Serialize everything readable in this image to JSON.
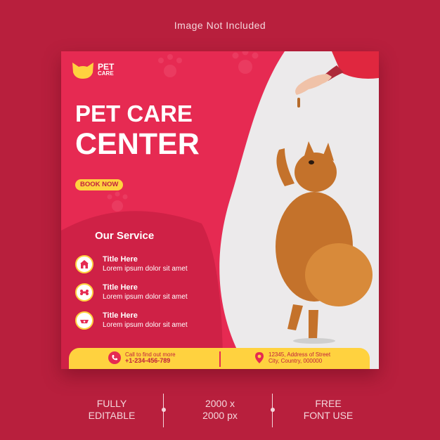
{
  "top_note": "Image Not Included",
  "logo": {
    "line1": "PET",
    "line2": "CARE"
  },
  "headline": {
    "line1": "PET CARE",
    "line2": "CENTER"
  },
  "cta": {
    "label": "BOOK NOW"
  },
  "services": {
    "title": "Our Service",
    "items": [
      {
        "title": "Title Here",
        "desc": "Lorem ipsum dolor sit amet",
        "icon": "dog-house-icon"
      },
      {
        "title": "Title Here",
        "desc": "Lorem ipsum dolor sit amet",
        "icon": "bone-icon"
      },
      {
        "title": "Title Here",
        "desc": "Lorem ipsum dolor sit amet",
        "icon": "pet-bowl-icon"
      }
    ]
  },
  "footer": {
    "phone_label": "Call to find out more",
    "phone": "+1-234-456-789",
    "address_line1": "12345, Address of Street",
    "address_line2": "City, Country, 000000"
  },
  "features": [
    {
      "line1": "FULLY",
      "line2": "EDITABLE"
    },
    {
      "line1": "2000 x",
      "line2": "2000 px"
    },
    {
      "line1": "FREE",
      "line2": "FONT USE"
    }
  ],
  "colors": {
    "background": "#b81f3d",
    "primary": "#e62a52",
    "accent": "#ffd23f",
    "photo_bg": "#eceaeb"
  }
}
